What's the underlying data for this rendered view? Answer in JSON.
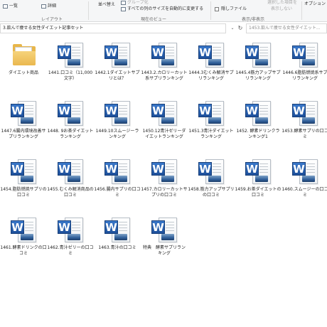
{
  "ribbon": {
    "row1": {
      "ichiran": "一覧",
      "shosai": "詳細",
      "sort_partial": "並べ替え",
      "group_partial": "グループ化",
      "fit_columns": "すべての列のサイズを自動的に変更する",
      "hidden_files": "隠しファイル",
      "hide_selected_partial": "選択した項目を",
      "hide_selected_line2": "表示しない",
      "options": "オプション"
    },
    "groups": {
      "layout": "レイアウト",
      "current_view": "現在のビュー",
      "show_hide": "表示/非表示"
    }
  },
  "address": {
    "path": "3.飲んで痩せる女性ダイエット記事セット",
    "search_placeholder": "1453.飲んで痩せる女性ダイエット..."
  },
  "files": [
    {
      "label": "ダイエット商品",
      "icon": "folder-icon"
    },
    {
      "label": "1441.口コミ（11,000文字）",
      "icon": "word-doc-icon"
    },
    {
      "label": "1442.1ダイエットサプリとは？",
      "icon": "word-doc-icon"
    },
    {
      "label": "1443.2.カロリーカット系サプリランキング",
      "icon": "word-doc-icon"
    },
    {
      "label": "1444.3むくみ解消サプリランキング",
      "icon": "word-doc-icon"
    },
    {
      "label": "1445.4筋力アップサプリランキング",
      "icon": "word-doc-icon"
    },
    {
      "label": "1446.6脂肪燃焼系サプリランキング",
      "icon": "word-doc-icon"
    },
    {
      "label": "1447.6腸内環境改善サプリランキング",
      "icon": "word-doc-icon"
    },
    {
      "label": "1448. 9お茶ダイエットランキング",
      "icon": "word-doc-icon"
    },
    {
      "label": "1449.10スムージーランキング",
      "icon": "word-doc-icon"
    },
    {
      "label": "1450.12青汁ゼリーダイエットランキング",
      "icon": "word-doc-icon"
    },
    {
      "label": "1451.3青汁ダイエットランキング",
      "icon": "word-doc-icon"
    },
    {
      "label": "1452. 酵素ドリンクランキング1",
      "icon": "word-doc-icon"
    },
    {
      "label": "1453.酵素サプリの口コミ",
      "icon": "word-doc-icon"
    },
    {
      "label": "1454.脂肪燃焼サプリの口コミ",
      "icon": "word-doc-icon"
    },
    {
      "label": "1455.むくみ解消商品の口コミ",
      "icon": "word-doc-icon"
    },
    {
      "label": "1456.腸内サプリの口コミ",
      "icon": "word-doc-icon"
    },
    {
      "label": "1457.カロリーカットサプリの口コミ",
      "icon": "word-doc-icon"
    },
    {
      "label": "1458.筋力アップサプリの口コミ",
      "icon": "word-doc-icon"
    },
    {
      "label": "1459.お茶ダイエットの口コミ",
      "icon": "word-doc-icon"
    },
    {
      "label": "1460.スムージーの口コミ",
      "icon": "word-doc-icon"
    },
    {
      "label": "1461.酵素ドリンクの口コミ",
      "icon": "word-doc-icon"
    },
    {
      "label": "1462.青汁ゼリーの口コミ",
      "icon": "word-doc-icon"
    },
    {
      "label": "1463.青汁の口コミ",
      "icon": "word-doc-icon"
    },
    {
      "label": "特典　酵素サプリランキング",
      "icon": "word-doc-icon"
    }
  ]
}
